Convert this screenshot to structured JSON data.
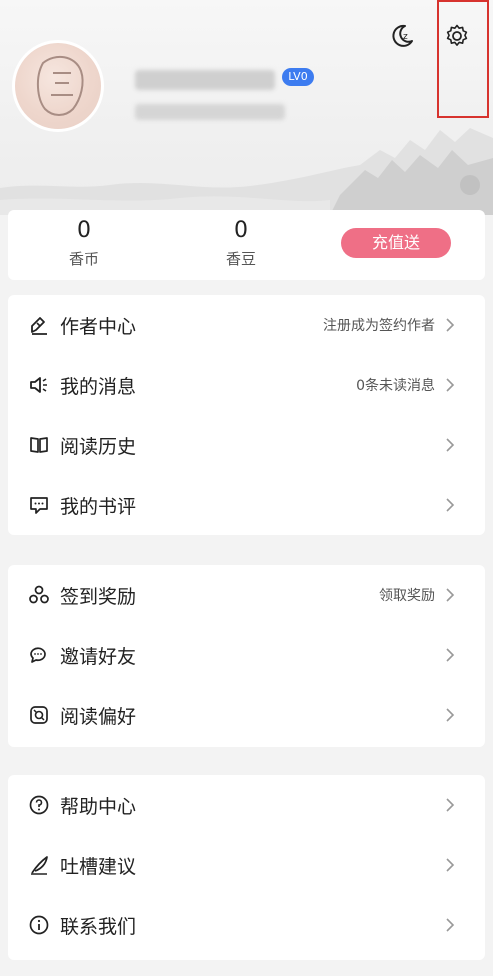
{
  "header": {
    "level_badge": "LV0"
  },
  "stats": {
    "coins_value": "0",
    "coins_label": "香币",
    "beans_value": "0",
    "beans_label": "香豆",
    "recharge_label": "充值送"
  },
  "menu_group_1": [
    {
      "label": "作者中心",
      "hint": "注册成为签约作者",
      "icon": "author-pen-icon"
    },
    {
      "label": "我的消息",
      "hint": "0条未读消息",
      "icon": "speaker-icon"
    },
    {
      "label": "阅读历史",
      "hint": "",
      "icon": "book-icon"
    },
    {
      "label": "我的书评",
      "hint": "",
      "icon": "comment-icon"
    }
  ],
  "menu_group_2": [
    {
      "label": "签到奖励",
      "hint": "领取奖励",
      "icon": "reward-icon"
    },
    {
      "label": "邀请好友",
      "hint": "",
      "icon": "chat-bubbles-icon"
    },
    {
      "label": "阅读偏好",
      "hint": "",
      "icon": "preference-icon"
    }
  ],
  "menu_group_3": [
    {
      "label": "帮助中心",
      "hint": "",
      "icon": "help-icon"
    },
    {
      "label": "吐槽建议",
      "hint": "",
      "icon": "feather-pen-icon"
    },
    {
      "label": "联系我们",
      "hint": "",
      "icon": "info-icon"
    }
  ],
  "colors": {
    "accent_pink": "#ef6f86",
    "level_blue": "#3d7cf0",
    "highlight_red": "#d7332e"
  }
}
